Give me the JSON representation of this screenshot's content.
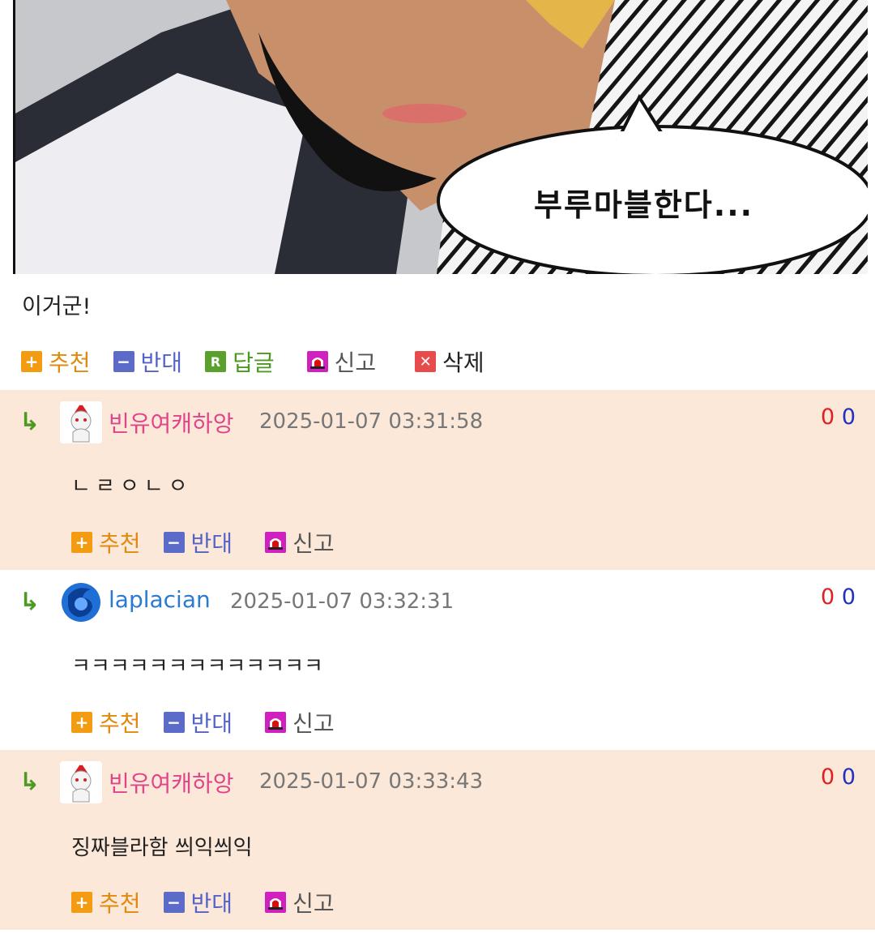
{
  "post": {
    "bubble_text": "부루마블한다...",
    "body_text": "이거군!",
    "actions": {
      "recommend": "추천",
      "oppose": "반대",
      "reply": "답글",
      "report": "신고",
      "delete": "삭제"
    }
  },
  "comments": [
    {
      "username": "빈유여캐하앙",
      "timestamp": "2025-01-07 03:31:58",
      "votes_up": "0",
      "votes_down": "0",
      "body": "ㄴㄹㅇㄴㅇ",
      "actions": {
        "recommend": "추천",
        "oppose": "반대",
        "report": "신고"
      }
    },
    {
      "username": "laplacian",
      "timestamp": "2025-01-07 03:32:31",
      "votes_up": "0",
      "votes_down": "0",
      "body": "ㅋㅋㅋㅋㅋㅋㅋㅋㅋㅋㅋㅋㅋ",
      "actions": {
        "recommend": "추천",
        "oppose": "반대",
        "report": "신고"
      }
    },
    {
      "username": "빈유여캐하앙",
      "timestamp": "2025-01-07 03:33:43",
      "votes_up": "0",
      "votes_down": "0",
      "body": "징짜블라함 씌익씌익",
      "actions": {
        "recommend": "추천",
        "oppose": "반대",
        "report": "신고"
      }
    }
  ],
  "colors": {
    "peach_bg": "#fbe8d8",
    "recommend": "#e08a10",
    "oppose": "#5563c8",
    "reply": "#4c9a22",
    "username_pink": "#e0448a",
    "username_blue": "#2a7bd0"
  }
}
